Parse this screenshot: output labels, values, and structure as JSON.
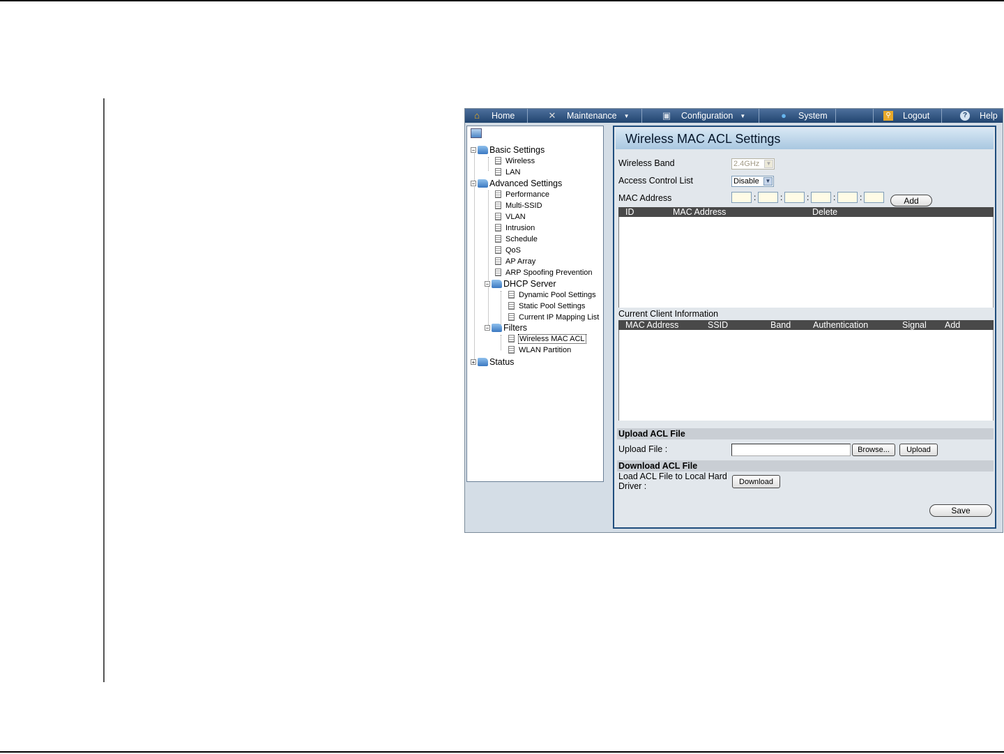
{
  "menubar": {
    "home": "Home",
    "maintenance": "Maintenance",
    "configuration": "Configuration",
    "system": "System",
    "logout": "Logout",
    "help": "Help"
  },
  "tree": {
    "basic_settings": "Basic Settings",
    "wireless": "Wireless",
    "lan": "LAN",
    "advanced_settings": "Advanced Settings",
    "performance": "Performance",
    "multi_ssid": "Multi-SSID",
    "vlan": "VLAN",
    "intrusion": "Intrusion",
    "schedule": "Schedule",
    "qos": "QoS",
    "ap_array": "AP Array",
    "arp": "ARP Spoofing Prevention",
    "dhcp_server": "DHCP Server",
    "dynamic_pool": "Dynamic Pool Settings",
    "static_pool": "Static Pool Settings",
    "ip_mapping": "Current IP Mapping List",
    "filters": "Filters",
    "wireless_mac_acl": "Wireless MAC ACL",
    "wlan_partition": "WLAN Partition",
    "status": "Status"
  },
  "panel": {
    "title": "Wireless MAC ACL Settings",
    "wireless_band_label": "Wireless Band",
    "wireless_band_value": "2.4GHz",
    "acl_label": "Access Control List",
    "acl_value": "Disable",
    "mac_label": "MAC Address",
    "add_button": "Add",
    "acl_table": {
      "col_id": "ID",
      "col_mac": "MAC Address",
      "col_delete": "Delete"
    },
    "client_info_label": "Current Client Information",
    "client_table": {
      "col_mac": "MAC Address",
      "col_ssid": "SSID",
      "col_band": "Band",
      "col_auth": "Authentication",
      "col_signal": "Signal",
      "col_add": "Add"
    },
    "upload_section": "Upload ACL File",
    "upload_file_label": "Upload File :",
    "browse_button": "Browse...",
    "upload_button": "Upload",
    "download_section": "Download ACL File",
    "download_label_line1": "Load ACL File to Local Hard",
    "download_label_line2": "Driver :",
    "download_button": "Download",
    "save_button": "Save"
  }
}
